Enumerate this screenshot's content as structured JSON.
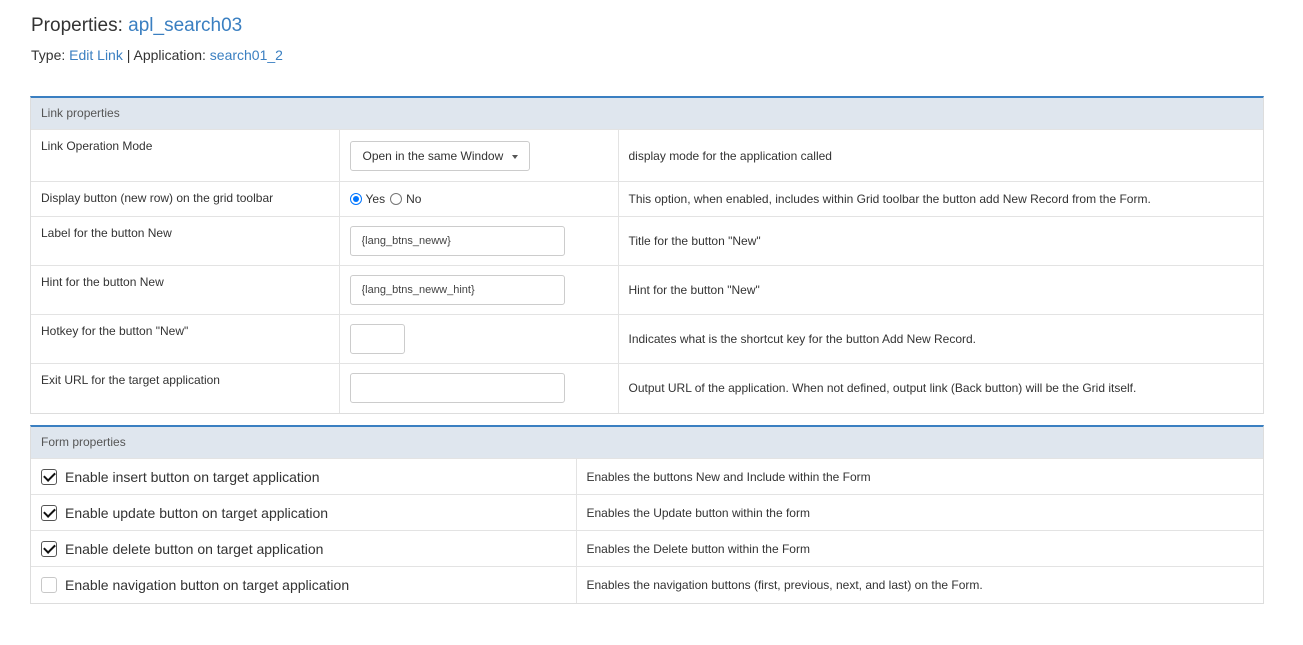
{
  "header": {
    "title_prefix": "Properties: ",
    "title_name": "apl_search03",
    "type_label": "Type: ",
    "type_value": "Edit Link",
    "separator": " | ",
    "app_label": "Application: ",
    "app_value": "search01_2"
  },
  "link_panel": {
    "heading": "Link properties",
    "rows": [
      {
        "label": "Link Operation Mode",
        "control": "select",
        "value": "Open in the same Window",
        "description": "display mode for the application called"
      },
      {
        "label": "Display button (new row) on the grid toolbar",
        "control": "radio",
        "options": [
          "Yes",
          "No"
        ],
        "selected": "Yes",
        "description": "This option, when enabled, includes within Grid toolbar the button add New Record from the Form."
      },
      {
        "label": "Label for the button New",
        "control": "text",
        "value": "{lang_btns_neww}",
        "description": "Title for the button \"New\""
      },
      {
        "label": "Hint for the button New",
        "control": "text",
        "value": "{lang_btns_neww_hint}",
        "description": "Hint for the button \"New\""
      },
      {
        "label": "Hotkey for the button \"New\"",
        "control": "text-small",
        "value": "",
        "description": "Indicates what is the shortcut key for the button Add New Record."
      },
      {
        "label": "Exit URL for the target application",
        "control": "text",
        "value": "",
        "description": "Output URL of the application. When not defined, output link (Back button) will be the Grid itself."
      }
    ]
  },
  "form_panel": {
    "heading": "Form properties",
    "rows": [
      {
        "label": "Enable insert button on target application",
        "checked": true,
        "description": "Enables the buttons New and Include within the Form"
      },
      {
        "label": "Enable update button on target application",
        "checked": true,
        "description": "Enables the Update button within the form"
      },
      {
        "label": "Enable delete button on target application",
        "checked": true,
        "description": "Enables the Delete button within the Form"
      },
      {
        "label": "Enable navigation button on target application",
        "checked": false,
        "description": "Enables the navigation buttons (first, previous, next, and last) on the Form."
      }
    ]
  },
  "colors": {
    "accent": "#3a7fc1",
    "panel_header_bg": "#dfe6ee",
    "radio_checked": "#0075ff"
  }
}
